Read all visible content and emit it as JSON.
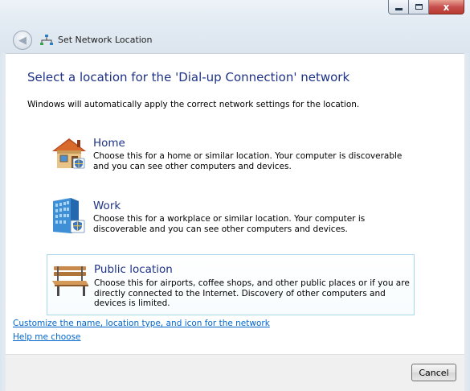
{
  "window": {
    "title": "Set Network Location",
    "close_glyph": "x"
  },
  "main": {
    "heading": "Select a location for the 'Dial-up Connection' network",
    "intro": "Windows will automatically apply the correct network settings for the location."
  },
  "options": [
    {
      "title": "Home",
      "description": "Choose this for a home or similar location. Your computer is discoverable and you can see other computers and devices.",
      "icon": "house-icon"
    },
    {
      "title": "Work",
      "description": "Choose this for a workplace or similar location. Your computer is discoverable and you can see other computers and devices.",
      "icon": "office-building-icon"
    },
    {
      "title": "Public location",
      "description": "Choose this for airports, coffee shops, and other public places or if you are directly connected to the Internet. Discovery of other computers and devices is limited.",
      "icon": "park-bench-icon",
      "selected": true
    }
  ],
  "links": {
    "customize": "Customize the name, location type, and icon for the network",
    "help": "Help me choose"
  },
  "footer": {
    "cancel_label": "Cancel"
  },
  "colors": {
    "heading": "#1e3287",
    "link": "#0066cc",
    "selection_border": "#a7d8ea"
  }
}
